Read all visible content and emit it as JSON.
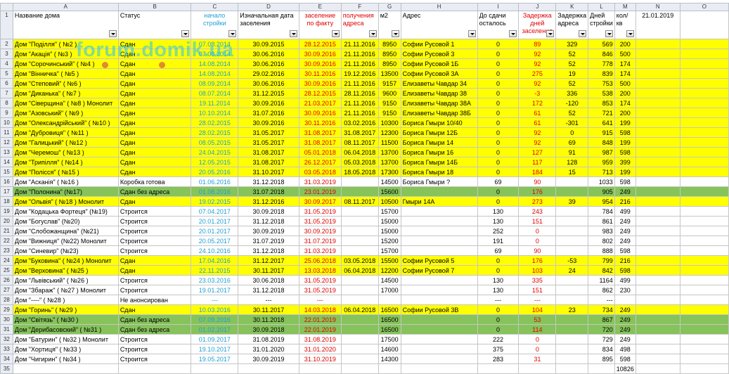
{
  "col_letters": [
    "A",
    "B",
    "C",
    "D",
    "E",
    "F",
    "G",
    "H",
    "I",
    "J",
    "K",
    "L",
    "M",
    "N",
    "O"
  ],
  "headers": {
    "a": "Название дома",
    "b": "Статус",
    "c": "начало стройки",
    "d": "Изначальная дата заселения",
    "e": "заселение по факту",
    "f": "получения адреса",
    "g": "м2",
    "h": "Адрес",
    "i": "До сдачи осталось",
    "j": "Задержка дней заселения",
    "k": "Задержка адреса",
    "l": "Дней стройки",
    "m": "кол/кв",
    "n": "21.01.2019"
  },
  "rows": [
    {
      "num": "2",
      "a": "Дом \"Поділля\" ( №2 )",
      "b": "Сдан",
      "c": "07.08.2014",
      "d": "30.09.2015",
      "e": "28.12.2015",
      "f": "21.11.2016",
      "g": "8950",
      "h": "Софии Русовой 1",
      "i": "0",
      "j": "89",
      "k": "329",
      "l": "569",
      "m": "200",
      "style": "yellow"
    },
    {
      "num": "3",
      "a": "Дом \"Акація\" ( №3 )",
      "b": "Сдан",
      "c": "07.08.2014",
      "d": "30.06.2016",
      "e": "30.09.2016",
      "f": "21.11.2016",
      "g": "8950",
      "h": "Софии Русовой 3",
      "i": "0",
      "j": "92",
      "k": "52",
      "l": "846",
      "m": "500",
      "style": "yellow"
    },
    {
      "num": "4",
      "a": "Дом \"Сорочинський\" ( №4 )",
      "b": "Сдан",
      "c": "14.08.2014",
      "d": "30.06.2016",
      "e": "30.09.2016",
      "f": "21.11.2016",
      "g": "8950",
      "h": "Софии Русовой 1Б",
      "i": "0",
      "j": "92",
      "k": "52",
      "l": "778",
      "m": "174",
      "style": "yellow"
    },
    {
      "num": "5",
      "a": "Дом \"Вінничка\" ( №5 )",
      "b": "Сдан",
      "c": "14.08.2014",
      "d": "29.02.2016",
      "e": "30.11.2016",
      "f": "19.12.2016",
      "g": "13500",
      "h": "Софии Русовой 3А",
      "i": "0",
      "j": "275",
      "k": "19",
      "l": "839",
      "m": "174",
      "style": "yellow"
    },
    {
      "num": "6",
      "a": "Дом \"Степовий\" ( №6 )",
      "b": "Сдан",
      "c": "08.09.2014",
      "d": "30.06.2016",
      "e": "30.09.2016",
      "f": "21.11.2016",
      "g": "9157",
      "h": "Елизаветы Чавдар 34",
      "i": "0",
      "j": "92",
      "k": "52",
      "l": "753",
      "m": "500",
      "style": "yellow"
    },
    {
      "num": "7",
      "a": "Дом \"Диканька\" ( №7 )",
      "b": "Сдан",
      "c": "08.07.2014",
      "d": "31.12.2015",
      "e": "28.12.2015",
      "f": "28.11.2016",
      "g": "9600",
      "h": "Елизаветы Чавдар 38",
      "i": "0",
      "j": "-3",
      "k": "336",
      "l": "538",
      "m": "200",
      "style": "yellow"
    },
    {
      "num": "8",
      "a": "Дом \"Сіверщина\" ( №8 ) Монолит",
      "b": "Сдан",
      "c": "19.11.2014",
      "d": "30.09.2016",
      "e": "21.03.2017",
      "f": "21.11.2016",
      "g": "9150",
      "h": "Елизаветы Чавдар 38А",
      "i": "0",
      "j": "172",
      "k": "-120",
      "l": "853",
      "m": "174",
      "style": "yellow"
    },
    {
      "num": "9",
      "a": "Дом \"Азовський\" ( №9 )",
      "b": "Сдан",
      "c": "10.10.2014",
      "d": "31.07.2016",
      "e": "30.09.2016",
      "f": "21.11.2016",
      "g": "9150",
      "h": "Елизаветы Чавдар 38Б",
      "i": "0",
      "j": "61",
      "k": "52",
      "l": "721",
      "m": "200",
      "style": "yellow"
    },
    {
      "num": "10",
      "a": "Дом \"Олександрійський\" ( №10 )",
      "b": "Сдан",
      "c": "28.02.2015",
      "d": "30.09.2016",
      "e": "30.11.2016",
      "f": "03.02.2016",
      "g": "10300",
      "h": "Бориса Гмыри 10/40",
      "i": "0",
      "j": "61",
      "k": "-301",
      "l": "641",
      "m": "199",
      "style": "yellow"
    },
    {
      "num": "11",
      "a": "Дом \"Дубровиця\" ( №11 )",
      "b": "Сдан",
      "c": "28.02.2015",
      "d": "31.05.2017",
      "e": "31.08.2017",
      "f": "31.08.2017",
      "g": "12300",
      "h": "Бориса Гмыри 12Б",
      "i": "0",
      "j": "92",
      "k": "0",
      "l": "915",
      "m": "598",
      "style": "yellow"
    },
    {
      "num": "12",
      "a": "Дом \"Галицький\" ( №12 )",
      "b": "Сдан",
      "c": "08.05.2015",
      "d": "31.05.2017",
      "e": "31.08.2017",
      "f": "08.11.2017",
      "g": "11500",
      "h": "Бориса Гмыри 14",
      "i": "0",
      "j": "92",
      "k": "69",
      "l": "848",
      "m": "199",
      "style": "yellow"
    },
    {
      "num": "13",
      "a": "Дом \"Черемош\" ( №13 )",
      "b": "Сдан",
      "c": "24.04.2015",
      "d": "31.08.2017",
      "e": "05.01.2018",
      "f": "06.04.2018",
      "g": "13700",
      "h": "Бориса Гмыри 16",
      "i": "0",
      "j": "127",
      "k": "91",
      "l": "987",
      "m": "598",
      "style": "yellow"
    },
    {
      "num": "14",
      "a": "Дом \"Трипілля\" ( №14 )",
      "b": "Сдан",
      "c": "12.05.2015",
      "d": "31.08.2017",
      "e": "26.12.2017",
      "f": "05.03.2018",
      "g": "13700",
      "h": "Бориса Гмыри 14Б",
      "i": "0",
      "j": "117",
      "k": "128",
      "l": "959",
      "m": "399",
      "style": "yellow"
    },
    {
      "num": "15",
      "a": "Дом \"Полісся\" ( №15 )",
      "b": "Сдан",
      "c": "20.05.2016",
      "d": "31.10.2017",
      "e": "03.05.2018",
      "f": "18.05.2018",
      "g": "17300",
      "h": "Бориса Гмыри 18",
      "i": "0",
      "j": "184",
      "k": "15",
      "l": "713",
      "m": "199",
      "style": "yellow"
    },
    {
      "num": "16",
      "a": "Дом \"Асканія\" ( №16 )",
      "b": "Коробка готова",
      "c": "01.06.2016",
      "d": "31.12.2018",
      "e": "31.03.2019",
      "f": "",
      "g": "14500",
      "h": "Бориса Гмыри ?",
      "i": "69",
      "j": "90",
      "k": "",
      "l": "1033",
      "m": "598",
      "style": ""
    },
    {
      "num": "17",
      "a": "Дом \"Полонина\" (№17)",
      "b": "Сдан без адреса",
      "c": "01.08.2016",
      "d": "31.07.2018",
      "e": "23.01.2019",
      "f": "",
      "g": "15600",
      "h": "",
      "i": "0",
      "j": "176",
      "k": "",
      "l": "905",
      "m": "249",
      "style": "green"
    },
    {
      "num": "18",
      "a": "Дом \"Ольвія\" ( №18 ) Монолит",
      "b": "Сдан",
      "c": "19.02.2015",
      "d": "31.12.2016",
      "e": "30.09.2017",
      "f": "08.11.2017",
      "g": "10500",
      "h": "Гмыри 14А",
      "i": "0",
      "j": "273",
      "k": "39",
      "l": "954",
      "m": "216",
      "style": "yellow"
    },
    {
      "num": "19",
      "a": "Дом \"Кодацька Фортеця\" (№19)",
      "b": "Строится",
      "c": "07.04.2017",
      "d": "30.09.2018",
      "e": "31.05.2019",
      "f": "",
      "g": "15700",
      "h": "",
      "i": "130",
      "j": "243",
      "k": "",
      "l": "784",
      "m": "499",
      "style": ""
    },
    {
      "num": "20",
      "a": "Дом \"Богуслав\" (№20)",
      "b": "Строится",
      "c": "20.01.2017",
      "d": "31.12.2018",
      "e": "31.05.2019",
      "f": "",
      "g": "15000",
      "h": "",
      "i": "130",
      "j": "151",
      "k": "",
      "l": "861",
      "m": "249",
      "style": ""
    },
    {
      "num": "21",
      "a": "Дом \"Слобожанщина\" (№21)",
      "b": "Строится",
      "c": "20.01.2017",
      "d": "30.09.2019",
      "e": "30.09.2019",
      "f": "",
      "g": "15000",
      "h": "",
      "i": "252",
      "j": "0",
      "k": "",
      "l": "983",
      "m": "249",
      "style": ""
    },
    {
      "num": "22",
      "a": "Дом \"Вижниця\" (№22) Монолит",
      "b": "Строится",
      "c": "20.05.2017",
      "d": "31.07.2019",
      "e": "31.07.2019",
      "f": "",
      "g": "15200",
      "h": "",
      "i": "191",
      "j": "0",
      "k": "",
      "l": "802",
      "m": "249",
      "style": ""
    },
    {
      "num": "23",
      "a": "Дом \"Синевир\" (№23)",
      "b": "Строится",
      "c": "24.10.2016",
      "d": "31.12.2018",
      "e": "31.03.2019",
      "f": "",
      "g": "15700",
      "h": "",
      "i": "69",
      "j": "90",
      "k": "",
      "l": "888",
      "m": "598",
      "style": ""
    },
    {
      "num": "24",
      "a": "Дом \"Буковина\" ( №24 ) Монолит",
      "b": "Сдан",
      "c": "17.04.2016",
      "d": "31.12.2017",
      "e": "25.06.2018",
      "f": "03.05.2018",
      "g": "15500",
      "h": "Софии Русовой 5",
      "i": "0",
      "j": "176",
      "k": "-53",
      "l": "799",
      "m": "216",
      "style": "yellow"
    },
    {
      "num": "25",
      "a": "Дом \"Верховина\" ( №25 )",
      "b": "Сдан",
      "c": "22.11.2015",
      "d": "30.11.2017",
      "e": "13.03.2018",
      "f": "06.04.2018",
      "g": "12200",
      "h": "Софии Русовой 7",
      "i": "0",
      "j": "103",
      "k": "24",
      "l": "842",
      "m": "598",
      "style": "yellow"
    },
    {
      "num": "26",
      "a": "Дом \"Львівський\" ( №26 )",
      "b": "Строится",
      "c": "23.03.2016",
      "d": "30.06.2018",
      "e": "31.05.2019",
      "f": "",
      "g": "14500",
      "h": "",
      "i": "130",
      "j": "335",
      "k": "",
      "l": "1164",
      "m": "499",
      "style": ""
    },
    {
      "num": "27",
      "a": "Дом \"Збараж\" ( №27 ) Монолит",
      "b": "Строится",
      "c": "19.01.2017",
      "d": "31.12.2018",
      "e": "31.05.2019",
      "f": "",
      "g": "17000",
      "h": "",
      "i": "130",
      "j": "151",
      "k": "",
      "l": "862",
      "m": "230",
      "style": ""
    },
    {
      "num": "28",
      "a": "Дом \"----\" ( №28 )",
      "b": "Не анонсирован",
      "c": "---",
      "d": "---",
      "e": "---",
      "f": "",
      "g": "",
      "h": "",
      "i": "---",
      "j": "---",
      "k": "",
      "l": "---",
      "m": "",
      "style": ""
    },
    {
      "num": "29",
      "a": "Дом \"Горинь\" ( №29 )",
      "b": "Сдан",
      "c": "10.03.2016",
      "d": "30.11.2017",
      "e": "14.03.2018",
      "f": "06.04.2018",
      "g": "16500",
      "h": "Софии Русовой 3В",
      "i": "0",
      "j": "104",
      "k": "23",
      "l": "734",
      "m": "249",
      "style": "yellow"
    },
    {
      "num": "30",
      "a": "Дом \"Світязь\" ( №30 )",
      "b": "Сдан без адреса",
      "c": "07.09.2016",
      "d": "30.11.2018",
      "e": "22.01.2019",
      "f": "",
      "g": "16500",
      "h": "",
      "i": "0",
      "j": "53",
      "k": "",
      "l": "867",
      "m": "249",
      "style": "green"
    },
    {
      "num": "31",
      "a": "Дом \"Дерибасовский\" ( №31 )",
      "b": "Сдан без адреса",
      "c": "01.02.2017",
      "d": "30.09.2018",
      "e": "22.01.2019",
      "f": "",
      "g": "16500",
      "h": "",
      "i": "0",
      "j": "114",
      "k": "",
      "l": "720",
      "m": "249",
      "style": "green"
    },
    {
      "num": "32",
      "a": "Дом \"Батурин\" ( №32 ) Монолит",
      "b": "Строится",
      "c": "01.09.2017",
      "d": "31.08.2019",
      "e": "31.08.2019",
      "f": "",
      "g": "17500",
      "h": "",
      "i": "222",
      "j": "0",
      "k": "",
      "l": "729",
      "m": "249",
      "style": ""
    },
    {
      "num": "33",
      "a": "Дом \"Хортиця\" ( №33 )",
      "b": "Строится",
      "c": "19.10.2017",
      "d": "31.01.2020",
      "e": "31.01.2020",
      "f": "",
      "g": "14600",
      "h": "",
      "i": "375",
      "j": "0",
      "k": "",
      "l": "834",
      "m": "498",
      "style": ""
    },
    {
      "num": "34",
      "a": "Дом \"Чигирин\" ( №34 )",
      "b": "Строится",
      "c": "19.05.2017",
      "d": "30.09.2019",
      "e": "31.10.2019",
      "f": "",
      "g": "14300",
      "h": "",
      "i": "283",
      "j": "31",
      "k": "",
      "l": "895",
      "m": "598",
      "style": ""
    }
  ],
  "total": {
    "num": "35",
    "m": "10826"
  },
  "watermark": "forum.domik.ua",
  "colors": {
    "yellow": "#ffff00",
    "green": "#86c35a",
    "blue": "#1f9fd6",
    "red": "#e00000"
  }
}
